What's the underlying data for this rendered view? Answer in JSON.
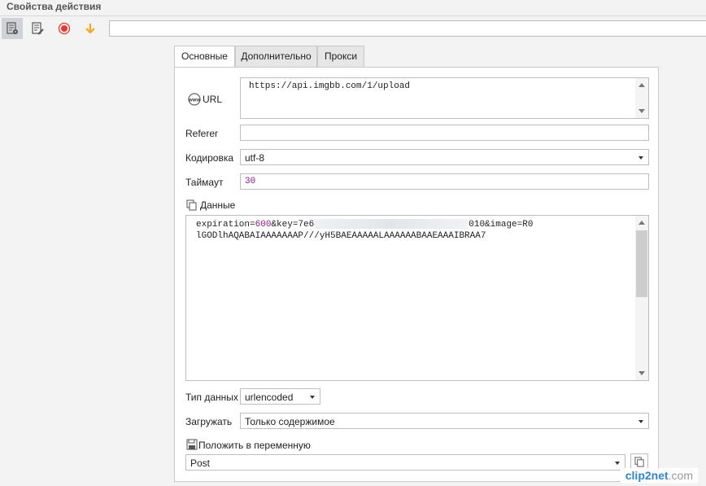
{
  "window": {
    "title": "Свойства действия"
  },
  "toolbar": {
    "buttons": [
      {
        "icon": "properties-icon"
      },
      {
        "icon": "edit-icon"
      },
      {
        "icon": "record-icon",
        "color": "#e53935"
      },
      {
        "icon": "arrow-down-icon",
        "color": "#f5a623"
      }
    ],
    "search_value": ""
  },
  "tabs": [
    {
      "label": "Основные",
      "active": true
    },
    {
      "label": "Дополнительно",
      "active": false
    },
    {
      "label": "Прокси",
      "active": false
    }
  ],
  "form": {
    "url": {
      "label": "URL",
      "value": "https://api.imgbb.com/1/upload"
    },
    "referer": {
      "label": "Referer",
      "value": ""
    },
    "encoding": {
      "label": "Кодировка",
      "value": "utf-8"
    },
    "timeout": {
      "label": "Таймаут",
      "value": "30"
    },
    "data": {
      "label": "Данные",
      "line1_a": "expiration=",
      "line1_num": "600",
      "line1_b": "&key=7e6",
      "line1_c": "010&image=R0",
      "line2": "lGODlhAQABAIAAAAAAAP///yH5BAEAAAAALAAAAAABAAEAAAIBRAA7"
    },
    "data_type": {
      "label": "Тип данных",
      "value": "urlencoded"
    },
    "load": {
      "label": "Загружать",
      "value": "Только содержимое"
    },
    "save_to_var": {
      "label": "Положить в переменную",
      "value": "Post"
    }
  },
  "watermark": {
    "brand": "clip2net",
    "suffix": ".com"
  },
  "colors": {
    "accent_record": "#e53935",
    "accent_arrow": "#f5a623",
    "number": "#8a1a8a"
  }
}
